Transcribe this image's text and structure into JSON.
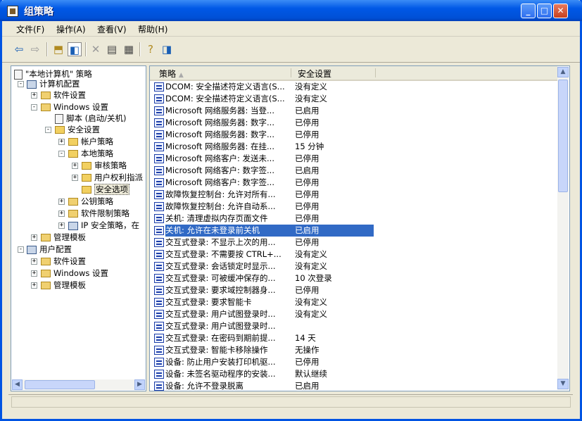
{
  "window": {
    "title": "组策略"
  },
  "menu": [
    "文件(F)",
    "操作(A)",
    "查看(V)",
    "帮助(H)"
  ],
  "tree": {
    "root": "\"本地计算机\" 策略",
    "nodes": [
      "计算机配置",
      "软件设置",
      "Windows 设置",
      "脚本 (启动/关机)",
      "安全设置",
      "帐户策略",
      "本地策略",
      "审核策略",
      "用户权利指派",
      "安全选项",
      "公钥策略",
      "软件限制策略",
      "IP 安全策略，在",
      "管理模板",
      "用户配置",
      "软件设置",
      "Windows 设置",
      "管理模板"
    ]
  },
  "list": {
    "columns": [
      "策略",
      "安全设置"
    ],
    "rows": [
      {
        "name": "DCOM: 安全描述符定义语言(S...",
        "value": "没有定义"
      },
      {
        "name": "DCOM: 安全描述符定义语言(S...",
        "value": "没有定义"
      },
      {
        "name": "Microsoft 网络服务器: 当登...",
        "value": "已启用"
      },
      {
        "name": "Microsoft 网络服务器: 数字...",
        "value": "已停用"
      },
      {
        "name": "Microsoft 网络服务器: 数字...",
        "value": "已停用"
      },
      {
        "name": "Microsoft 网络服务器: 在挂...",
        "value": "15 分钟"
      },
      {
        "name": "Microsoft 网络客户: 发送未...",
        "value": "已停用"
      },
      {
        "name": "Microsoft 网络客户: 数字签...",
        "value": "已启用"
      },
      {
        "name": "Microsoft 网络客户: 数字签...",
        "value": "已停用"
      },
      {
        "name": "故障恢复控制台: 允许对所有...",
        "value": "已停用"
      },
      {
        "name": "故障恢复控制台: 允许自动系...",
        "value": "已停用"
      },
      {
        "name": "关机: 清理虚拟内存页面文件",
        "value": "已停用"
      },
      {
        "name": "关机: 允许在未登录前关机",
        "value": "已启用"
      },
      {
        "name": "交互式登录: 不显示上次的用...",
        "value": "已停用"
      },
      {
        "name": "交互式登录: 不需要按 CTRL+...",
        "value": "没有定义"
      },
      {
        "name": "交互式登录: 会话锁定时显示...",
        "value": "没有定义"
      },
      {
        "name": "交互式登录: 可被缓冲保存的...",
        "value": "10 次登录"
      },
      {
        "name": "交互式登录: 要求域控制器身...",
        "value": "已停用"
      },
      {
        "name": "交互式登录: 要求智能卡",
        "value": "没有定义"
      },
      {
        "name": "交互式登录: 用户试图登录时...",
        "value": "没有定义"
      },
      {
        "name": "交互式登录: 用户试图登录时...",
        "value": ""
      },
      {
        "name": "交互式登录: 在密码到期前提...",
        "value": "14 天"
      },
      {
        "name": "交互式登录: 智能卡移除操作",
        "value": "无操作"
      },
      {
        "name": "设备: 防止用户安装打印机驱...",
        "value": "已停用"
      },
      {
        "name": "设备: 未签名驱动程序的安装...",
        "value": "默认继续"
      },
      {
        "name": "设备: 允许不登录脱离",
        "value": "已启用"
      }
    ]
  }
}
